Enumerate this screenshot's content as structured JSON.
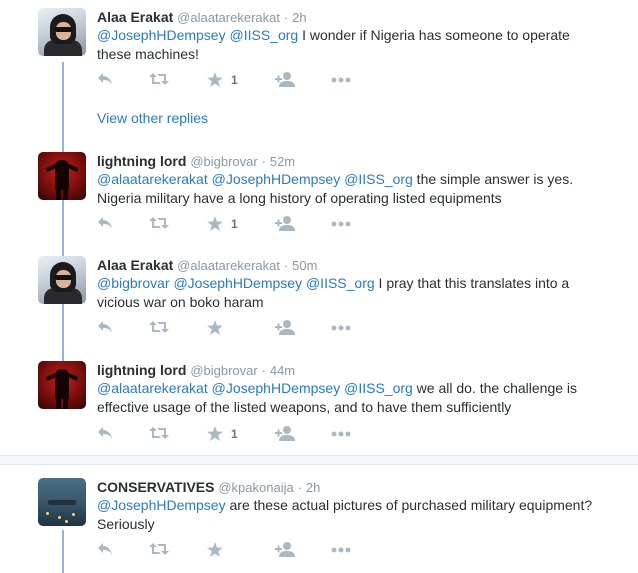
{
  "view_other_replies": "View other replies",
  "tweets": [
    {
      "name": "Alaa Erakat",
      "handle": "@alaatarekerakat",
      "time": "2h",
      "mentions": [
        "@JosephHDempsey",
        "@IISS_org"
      ],
      "text": " I wonder if Nigeria has someone to operate these machines!",
      "fav_count": "1",
      "avatar": "alaa-avatar"
    },
    {
      "name": "lightning lord",
      "handle": "@bigbrovar",
      "time": "52m",
      "mentions": [
        "@alaatarekerakat",
        "@JosephHDempsey",
        "@IISS_org"
      ],
      "text": " the simple answer is yes. Nigeria military have a long history of operating listed equipments",
      "fav_count": "1",
      "avatar": "lightning-avatar"
    },
    {
      "name": "Alaa Erakat",
      "handle": "@alaatarekerakat",
      "time": "50m",
      "mentions": [
        "@bigbrovar",
        "@JosephHDempsey",
        "@IISS_org"
      ],
      "text": " I pray that this translates into a vicious war on boko haram",
      "fav_count": "",
      "avatar": "alaa-avatar"
    },
    {
      "name": "lightning lord",
      "handle": "@bigbrovar",
      "time": "44m",
      "mentions": [
        "@alaatarekerakat",
        "@JosephHDempsey",
        "@IISS_org"
      ],
      "text": " we all do. the challenge is effective usage of the listed weapons, and to have them sufficiently",
      "fav_count": "1",
      "avatar": "lightning-avatar"
    },
    {
      "name": "CONSERVATIVES",
      "handle": "@kpakonaija",
      "time": "2h",
      "mentions": [
        "@JosephHDempsey"
      ],
      "text": " are these actual pictures of purchased military equipment? Seriously",
      "fav_count": "",
      "avatar": "conservatives-avatar"
    }
  ],
  "separator_dot": "·",
  "colors": {
    "link": "#2b7bb9",
    "thread_line": "#8fb5d9",
    "action_icon": "#aab8c2",
    "meta_text": "#8899a6"
  }
}
